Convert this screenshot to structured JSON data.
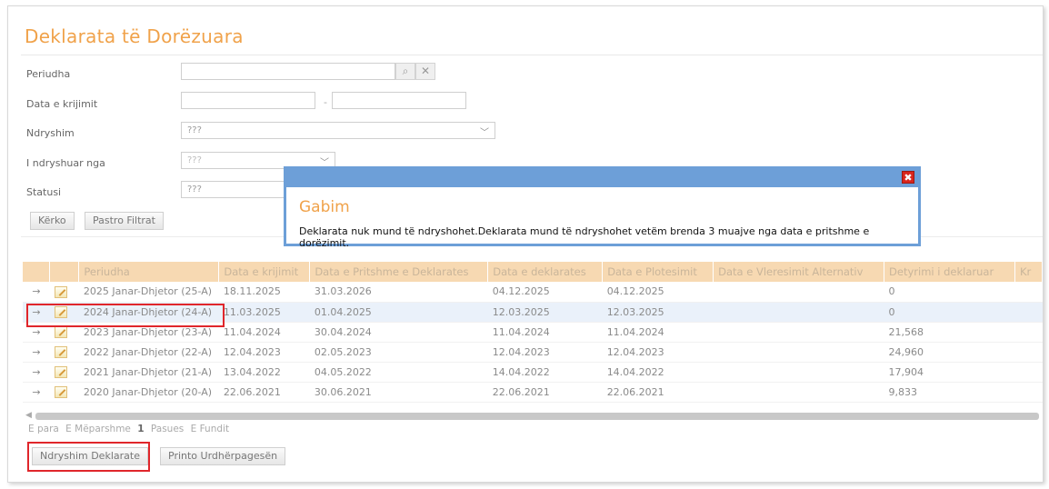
{
  "page": {
    "title": "Deklarata të Dorëzuara"
  },
  "filters": {
    "periudha_label": "Periudha",
    "data_krijimit_label": "Data e krijimit",
    "date_separator": "-",
    "ndryshim_label": "Ndryshim",
    "ndryshim_value": "???",
    "ndryshuar_nga_label": "I ndryshuar nga",
    "ndryshuar_nga_value": "???",
    "statusi_label": "Statusi",
    "statusi_value": "???",
    "search_button": "Kërko",
    "clear_button": "Pastro Filtrat"
  },
  "grid": {
    "columns": [
      "",
      "",
      "Periudha",
      "Data e krijimit",
      "Data e Pritshme e Deklarates",
      "Data e deklarates",
      "Data e Plotesimit",
      "Data e Vleresimit Alternativ",
      "Detyrimi i deklaruar",
      "Kr"
    ],
    "rows": [
      {
        "periudha": "2025 Janar-Dhjetor (25-A)",
        "krijimit": "18.11.2025",
        "pritshme": "31.03.2026",
        "deklarates": "04.12.2025",
        "plotesimit": "04.12.2025",
        "alternativ": "",
        "detyrimi": "0"
      },
      {
        "periudha": "2024 Janar-Dhjetor (24-A)",
        "krijimit": "11.03.2025",
        "pritshme": "01.04.2025",
        "deklarates": "12.03.2025",
        "plotesimit": "12.03.2025",
        "alternativ": "",
        "detyrimi": "0"
      },
      {
        "periudha": "2023 Janar-Dhjetor (23-A)",
        "krijimit": "11.04.2024",
        "pritshme": "30.04.2024",
        "deklarates": "11.04.2024",
        "plotesimit": "11.04.2024",
        "alternativ": "",
        "detyrimi": "21,568"
      },
      {
        "periudha": "2022 Janar-Dhjetor (22-A)",
        "krijimit": "12.04.2023",
        "pritshme": "02.05.2023",
        "deklarates": "12.04.2023",
        "plotesimit": "12.04.2023",
        "alternativ": "",
        "detyrimi": "24,960"
      },
      {
        "periudha": "2021 Janar-Dhjetor (21-A)",
        "krijimit": "13.04.2022",
        "pritshme": "04.05.2022",
        "deklarates": "14.04.2022",
        "plotesimit": "14.04.2022",
        "alternativ": "",
        "detyrimi": "17,904"
      },
      {
        "periudha": "2020 Janar-Dhjetor (20-A)",
        "krijimit": "22.06.2021",
        "pritshme": "30.06.2021",
        "deklarates": "22.06.2021",
        "plotesimit": "22.06.2021",
        "alternativ": "",
        "detyrimi": "9,833"
      }
    ],
    "selected_row": 1,
    "row_arrow": "→"
  },
  "pager": {
    "first": "E para",
    "prev": "E Mëparshme",
    "current": "1",
    "next": "Pasues",
    "last": "E Fundit"
  },
  "actions": {
    "change_button": "Ndryshim Deklarate",
    "print_button": "Printo Urdhërpagesën"
  },
  "modal": {
    "title": "Gabim",
    "message": "Deklarata nuk mund të ndryshohet.Deklarata mund të ndryshohet vetëm brenda 3 muajve nga data e pritshme e dorëzimit.",
    "close_symbol": "✖"
  },
  "colors": {
    "accent": "#f0a24a",
    "modal_border": "#6d9fd8",
    "highlight": "#e0262b",
    "header_bg": "#f7d9b2"
  }
}
